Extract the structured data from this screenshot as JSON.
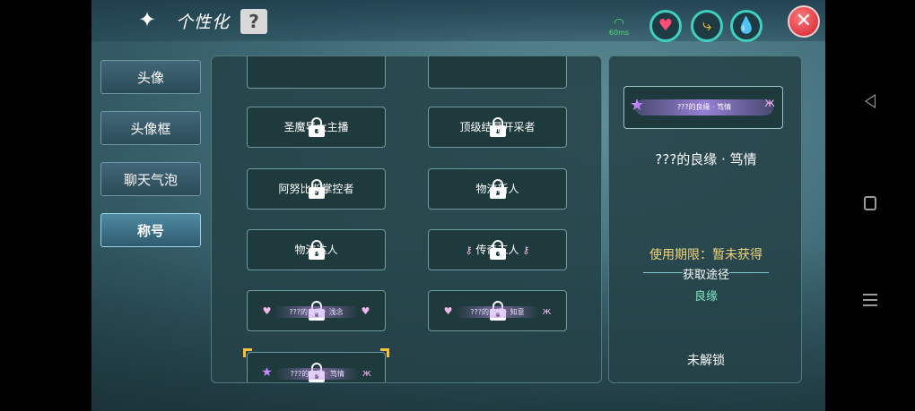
{
  "header": {
    "title": "个性化",
    "help_label": "?",
    "ping": "60ms",
    "close_label": "✕",
    "quick_buttons": [
      {
        "name": "heart",
        "glyph": "♥"
      },
      {
        "name": "share",
        "glyph": "⤷"
      },
      {
        "name": "drop",
        "glyph": "💧"
      }
    ]
  },
  "tabs": [
    {
      "label": "头像",
      "active": false
    },
    {
      "label": "头像框",
      "active": false
    },
    {
      "label": "聊天气泡",
      "active": false
    },
    {
      "label": "称号",
      "active": true
    }
  ],
  "titles": [
    {
      "label": "",
      "locked": false
    },
    {
      "label": "",
      "locked": false
    },
    {
      "label": "圣魔导大主播",
      "locked": true
    },
    {
      "label": "顶级结晶开采者",
      "locked": true
    },
    {
      "label": "阿努比斯掌控者",
      "locked": true
    },
    {
      "label": "物流新人",
      "locked": true
    },
    {
      "label": "物流达人",
      "locked": true
    },
    {
      "label": "传奇工人",
      "locked": true
    },
    {
      "label": "???的良缘 · 浅念",
      "locked": true
    },
    {
      "label": "???的良缘 · 知意",
      "locked": true
    },
    {
      "label": "???的良缘 · 笃情",
      "locked": true,
      "selected": true
    }
  ],
  "detail": {
    "preview_text": "???的良缘 · 笃情",
    "name": "???的良缘 · 笃情",
    "period": "使用期限：暂未获得",
    "source_heading": "获取途径",
    "source_value": "良缘",
    "status": "未解锁"
  },
  "colors": {
    "accent_teal": "#3fcfbf",
    "gold": "#f2c33a",
    "close_red": "#d21f2f",
    "ping_green": "#4fe06e"
  }
}
